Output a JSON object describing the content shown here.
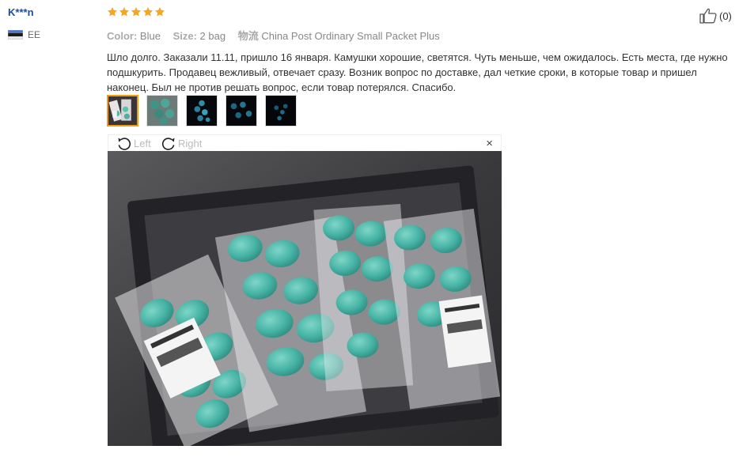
{
  "user": {
    "name": "K***n",
    "country": "EE"
  },
  "review": {
    "stars": 5,
    "star_color": "#f6a623",
    "attributes": [
      {
        "key": "Color:",
        "value": "Blue"
      },
      {
        "key": "Size:",
        "value": "2 bag"
      },
      {
        "key": "物流",
        "value": "China Post Ordinary Small Packet Plus"
      }
    ],
    "text": "Шло долго. Заказали 11.11, пришло 16 января. Камушки хорошие, светятся. Чуть меньше, чем ожидалось. Есть места, где нужно подшкурить. Продавец вежливый, отвечает сразу. Возник вопрос по доставке, дал четкие сроки, в которые товар и пришел наконец. Был не против решать вопрос, если товар потерялся. Спасибо."
  },
  "viewer": {
    "rotate_left_label": "Left",
    "rotate_right_label": "Right",
    "close_label": "×",
    "selected_thumbnail": 1,
    "thumbnail_count": 5
  },
  "like": {
    "count": "(0)"
  },
  "icons": {
    "star": "star-icon",
    "like": "thumbs-up-icon",
    "rotate_left": "rotate-left-icon",
    "rotate_right": "rotate-right-icon",
    "close": "close-icon",
    "flag": "flag-icon"
  }
}
